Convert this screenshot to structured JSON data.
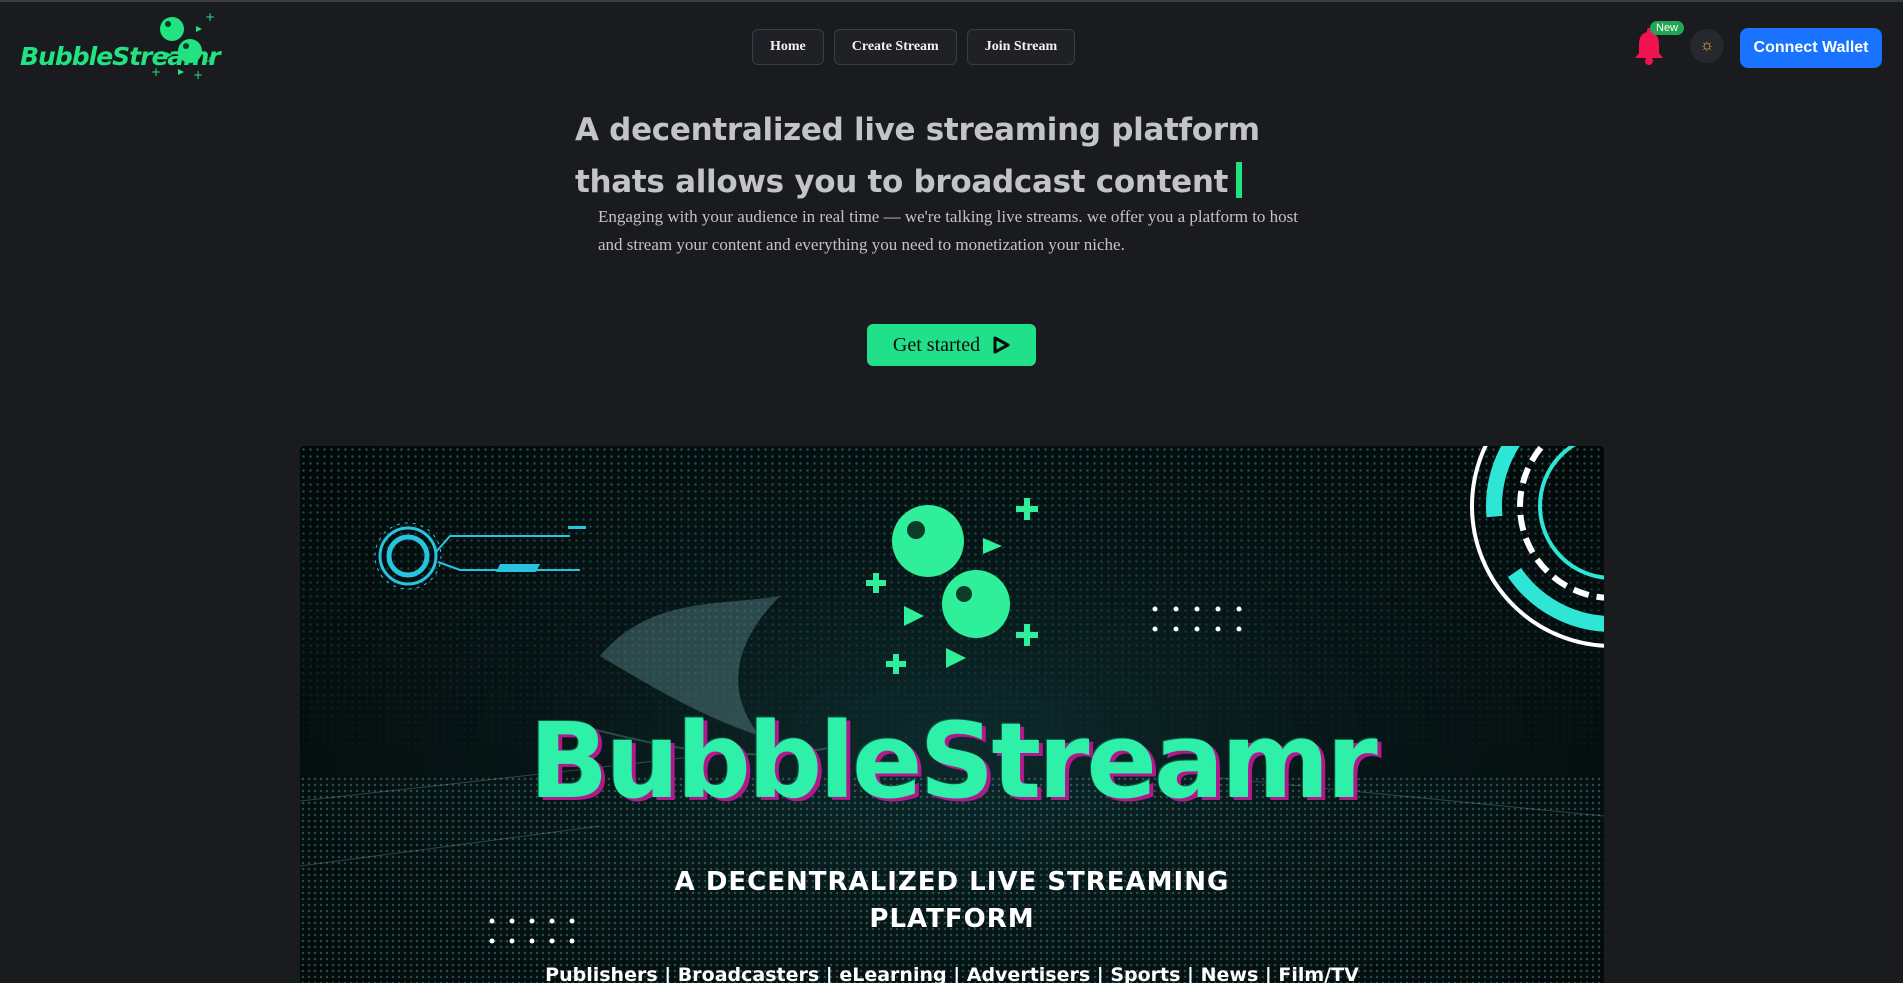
{
  "brand": {
    "name": "BubbleStreamr",
    "accent": "#21e37f"
  },
  "nav": {
    "items": [
      {
        "label": "Home"
      },
      {
        "label": "Create Stream"
      },
      {
        "label": "Join Stream"
      }
    ]
  },
  "header": {
    "notification_badge": "New",
    "bell_icon": "bell-icon",
    "theme_icon": "sun-icon",
    "connect_wallet": "Connect Wallet",
    "wallet_color": "#1a73ff"
  },
  "hero": {
    "headline": "A decentralized live streaming platform thats allows you to broadcast content",
    "subtext": "Engaging with your audience in real time — we're talking live streams. we offer you a platform to host and stream your content and everything you need to monetization your niche.",
    "cta": "Get started",
    "cta_icon": "play-icon",
    "cta_color": "#21e08a"
  },
  "banner": {
    "title": "BubbleStreamr",
    "tagline_line1": "A DECENTRALIZED LIVE STREAMING",
    "tagline_line2": "PLATFORM",
    "categories": "Publishers | Broadcasters | eLearning | Advertisers | Sports | News | Film/TV"
  }
}
